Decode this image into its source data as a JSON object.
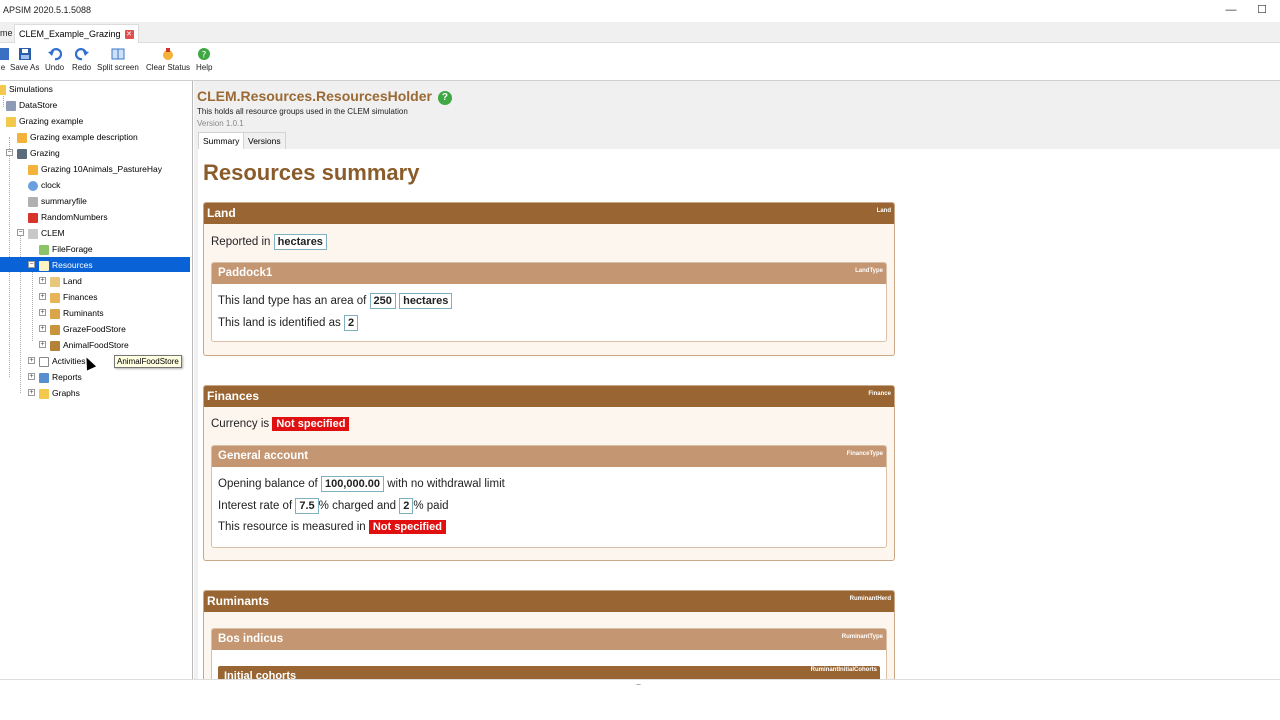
{
  "window": {
    "title": "APSIM 2020.5.1.5088",
    "minimize": "—",
    "maximize": "☐"
  },
  "tabs": {
    "home": "me",
    "active": "CLEM_Example_Grazing",
    "close": "✕"
  },
  "toolbar": {
    "items": [
      {
        "label": "e"
      },
      {
        "label": "Save As"
      },
      {
        "label": "Undo"
      },
      {
        "label": "Redo"
      },
      {
        "label": "Split screen"
      },
      {
        "label": "Clear Status"
      },
      {
        "label": "Help"
      }
    ]
  },
  "tree": {
    "nodes": [
      {
        "label": "Simulations"
      },
      {
        "label": "DataStore"
      },
      {
        "label": "Grazing example"
      },
      {
        "label": "Grazing example description"
      },
      {
        "label": "Grazing"
      },
      {
        "label": "Grazing 10Animals_PastureHay"
      },
      {
        "label": "clock"
      },
      {
        "label": "summaryfile"
      },
      {
        "label": "RandomNumbers"
      },
      {
        "label": "CLEM"
      },
      {
        "label": "FileForage"
      },
      {
        "label": "Resources"
      },
      {
        "label": "Land"
      },
      {
        "label": "Finances"
      },
      {
        "label": "Ruminants"
      },
      {
        "label": "GrazeFoodStore"
      },
      {
        "label": "AnimalFoodStore"
      },
      {
        "label": "Activities"
      },
      {
        "label": "Reports"
      },
      {
        "label": "Graphs"
      }
    ],
    "tooltip": "AnimalFoodStore"
  },
  "panel": {
    "title": "CLEM.Resources.ResourcesHolder",
    "help_icon": "?",
    "description": "This holds all resource groups used in the CLEM simulation",
    "version": "Version 1.0.1",
    "tabs": [
      "Summary",
      "Versions"
    ],
    "summary_title": "Resources summary",
    "land": {
      "heading": "Land",
      "tag": "Land",
      "reported_prefix": "Reported in",
      "reported_unit": "hectares",
      "paddock": {
        "heading": "Paddock1",
        "tag": "LandType",
        "area_prefix": "This land type has an area of",
        "area_value": "250",
        "area_unit": "hectares",
        "id_prefix": "This land is identified as",
        "id_value": "2"
      }
    },
    "finances": {
      "heading": "Finances",
      "tag": "Finance",
      "currency_prefix": "Currency is",
      "currency_value": "Not specified",
      "account": {
        "heading": "General account",
        "tag": "FinanceType",
        "opening_prefix": "Opening balance of",
        "opening_value": "100,000.00",
        "opening_suffix": "with no withdrawal limit",
        "interest_prefix": "Interest rate of",
        "interest_charged": "7.5",
        "interest_mid": "% charged and",
        "interest_paid": "2",
        "interest_suffix": "% paid",
        "measured_prefix": "This resource is measured in",
        "measured_value": "Not specified"
      }
    },
    "ruminants": {
      "heading": "Ruminants",
      "tag": "RuminantHerd",
      "type": {
        "heading": "Bos indicus",
        "tag": "RuminantType",
        "sub_heading": "Initial cohorts",
        "sub_tag": "RuminantInitialCohorts"
      }
    }
  },
  "status": {
    "grip": "......"
  }
}
